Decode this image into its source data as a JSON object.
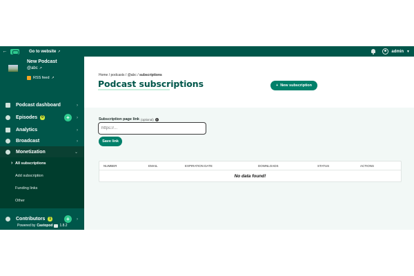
{
  "topbar": {
    "back_icon": "arrow-left-icon",
    "goto_label": "Go to website",
    "user_label": "admin"
  },
  "podcast": {
    "title": "New Podcast",
    "handle": "@abc",
    "rss_label": "RSS feed"
  },
  "sidebar": {
    "items": [
      {
        "label": "Podcast dashboard",
        "icon": "dashboard-icon"
      },
      {
        "label": "Episodes",
        "icon": "episodes-icon",
        "badge": "0"
      },
      {
        "label": "Analytics",
        "icon": "analytics-icon"
      },
      {
        "label": "Broadcast",
        "icon": "broadcast-icon"
      },
      {
        "label": "Monetization",
        "icon": "monetization-icon"
      }
    ],
    "submenu": [
      {
        "label": "All subscriptions",
        "active": true
      },
      {
        "label": "Add subscription"
      },
      {
        "label": "Funding links"
      },
      {
        "label": "Other"
      }
    ],
    "contributors": {
      "label": "Contributors",
      "badge": "1"
    },
    "powered_by_prefix": "Powered by",
    "powered_by_brand": "Castopod",
    "version": "1.8.2"
  },
  "main": {
    "breadcrumb": [
      "Home",
      "podcasts",
      "@abc",
      "subscriptions"
    ],
    "title": "Podcast subscriptions",
    "new_button": "New subscription",
    "form": {
      "label": "Subscription page link",
      "optional": "(optional)",
      "placeholder": "https://...",
      "save_label": "Save link"
    },
    "table": {
      "columns": [
        "NUMBER",
        "EMAIL",
        "EXPIRATION DATE",
        "DOWNLOADS",
        "STATUS",
        "ACTIONS"
      ],
      "empty_message": "No data found!"
    }
  },
  "colors": {
    "brand_dark": "#00564a",
    "accent": "#00806a",
    "badge": "#cdea3b"
  }
}
